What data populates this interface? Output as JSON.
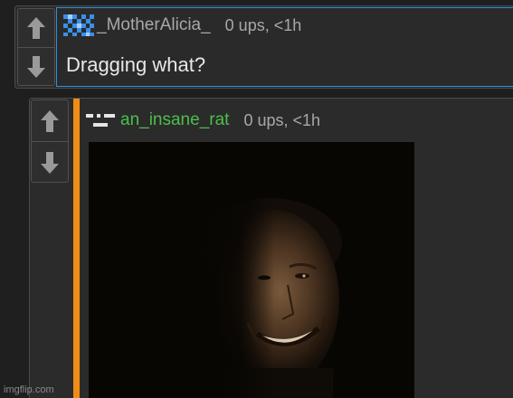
{
  "comments": [
    {
      "username": "_MotherAlicia_",
      "meta": "0 ups, <1h",
      "text": "Dragging what?",
      "avatar": "pixel-avatar-blue",
      "upvote_icon": "arrow-up-icon",
      "downvote_icon": "arrow-down-icon"
    },
    {
      "username": "an_insane_rat",
      "meta": "0 ups, <1h",
      "avatar": "pixel-avatar-white",
      "image_alt": "grinning man in darkness",
      "upvote_icon": "arrow-up-icon",
      "downvote_icon": "arrow-down-icon"
    }
  ],
  "watermark": "imgflip.com",
  "colors": {
    "background": "#1f1f1f",
    "comment_bg": "#2b2b2b",
    "focus_border": "#2d8fd8",
    "reply_bar": "#f08c15",
    "username_green": "#4bbf4b",
    "meta_text": "#a8a8a8"
  }
}
